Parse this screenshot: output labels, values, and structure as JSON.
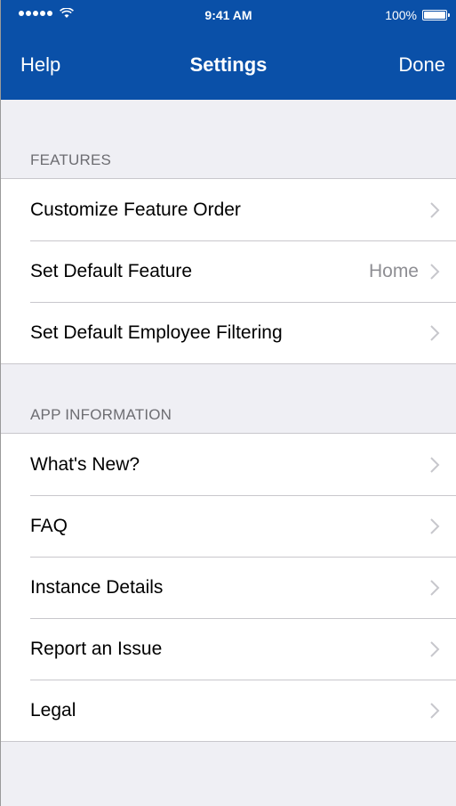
{
  "status_bar": {
    "time": "9:41 AM",
    "battery": "100%"
  },
  "nav": {
    "left_label": "Help",
    "title": "Settings",
    "right_label": "Done"
  },
  "sections": [
    {
      "header": "FEATURES",
      "rows": [
        {
          "label": "Customize Feature Order",
          "value": ""
        },
        {
          "label": "Set Default Feature",
          "value": "Home"
        },
        {
          "label": "Set Default Employee Filtering",
          "value": ""
        }
      ]
    },
    {
      "header": "APP INFORMATION",
      "rows": [
        {
          "label": "What's New?",
          "value": ""
        },
        {
          "label": "FAQ",
          "value": ""
        },
        {
          "label": "Instance Details",
          "value": ""
        },
        {
          "label": "Report an Issue",
          "value": ""
        },
        {
          "label": "Legal",
          "value": ""
        }
      ]
    }
  ],
  "colors": {
    "header_bg": "#0a50a8",
    "page_bg": "#efeff4"
  },
  "icons": [
    "signal-dots-icon",
    "wifi-icon",
    "battery-icon",
    "chevron-right-icon"
  ]
}
